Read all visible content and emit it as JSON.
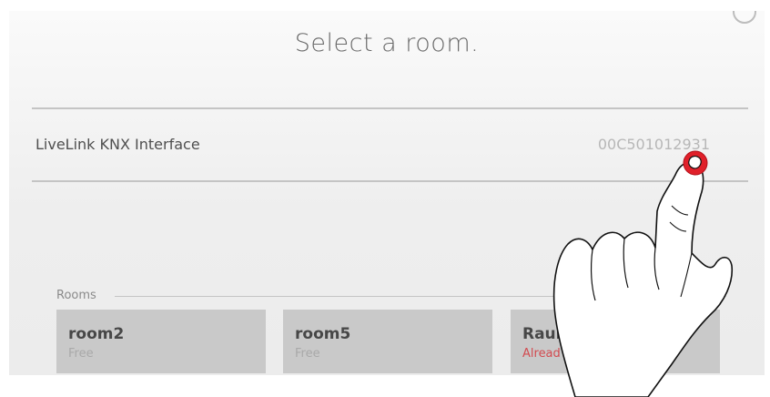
{
  "header": {
    "title": "Select a room."
  },
  "device": {
    "name": "LiveLink KNX Interface",
    "id": "00C501012931"
  },
  "rooms_section": {
    "label": "Rooms",
    "rooms": [
      {
        "name": "room2",
        "status": "Free"
      },
      {
        "name": "room5",
        "status": "Free"
      },
      {
        "name": "Raum",
        "status": "Alread"
      }
    ]
  },
  "colors": {
    "busy_status": "#d24b50",
    "tap_indicator": "#e0202a"
  },
  "icons": {
    "overlay": "pointing-hand-icon",
    "tap": "tap-indicator-icon"
  }
}
